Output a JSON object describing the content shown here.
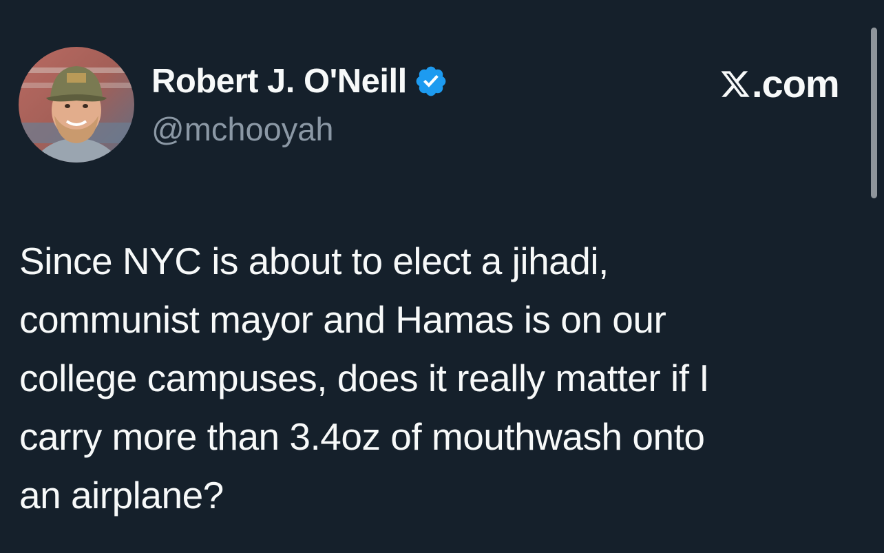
{
  "author": {
    "display_name": "Robert J. O'Neill",
    "handle": "@mchooyah",
    "verified": true,
    "avatar_icon": "profile-photo-man-in-cap"
  },
  "site": {
    "label": ".com",
    "logo_icon": "x-logo"
  },
  "tweet": {
    "lines": [
      "Since NYC is about to elect a jihadi,",
      "communist mayor and Hamas is on our",
      "college campuses, does it really matter if I",
      "carry more than 3.4oz of mouthwash onto",
      "an airplane?"
    ]
  },
  "colors": {
    "background": "#15202b",
    "text_primary": "#f7f9f9",
    "text_secondary": "#8b98a5",
    "verified_blue": "#1d9bf0"
  }
}
